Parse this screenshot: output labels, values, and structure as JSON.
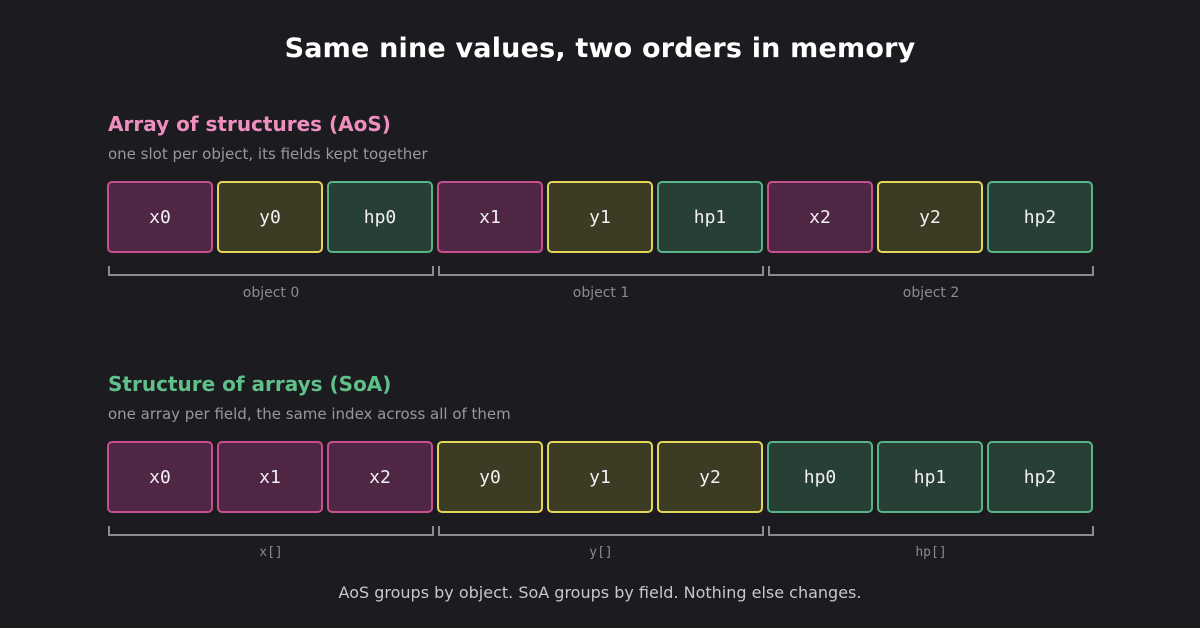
{
  "title": "Same nine values, two orders in memory",
  "colors": {
    "background": "#1c1b1f",
    "x_fill": "#4f2744",
    "x_border": "#c6508f",
    "y_fill": "#3c3b24",
    "y_border": "#e3d659",
    "hp_fill": "#283f36",
    "hp_border": "#57b488",
    "aos_heading": "#ef8fc0",
    "soa_heading": "#5fc08a"
  },
  "aos": {
    "heading": "Array of structures (AoS)",
    "subtitle": "one slot per object, its fields kept together",
    "cells": [
      {
        "label": "x0",
        "field": "x"
      },
      {
        "label": "y0",
        "field": "y"
      },
      {
        "label": "hp0",
        "field": "hp"
      },
      {
        "label": "x1",
        "field": "x"
      },
      {
        "label": "y1",
        "field": "y"
      },
      {
        "label": "hp1",
        "field": "hp"
      },
      {
        "label": "x2",
        "field": "x"
      },
      {
        "label": "y2",
        "field": "y"
      },
      {
        "label": "hp2",
        "field": "hp"
      }
    ],
    "groups": [
      "object 0",
      "object 1",
      "object 2"
    ]
  },
  "soa": {
    "heading": "Structure of arrays (SoA)",
    "subtitle": "one array per field, the same index across all of them",
    "cells": [
      {
        "label": "x0",
        "field": "x"
      },
      {
        "label": "x1",
        "field": "x"
      },
      {
        "label": "x2",
        "field": "x"
      },
      {
        "label": "y0",
        "field": "y"
      },
      {
        "label": "y1",
        "field": "y"
      },
      {
        "label": "y2",
        "field": "y"
      },
      {
        "label": "hp0",
        "field": "hp"
      },
      {
        "label": "hp1",
        "field": "hp"
      },
      {
        "label": "hp2",
        "field": "hp"
      }
    ],
    "groups": [
      "x[]",
      "y[]",
      "hp[]"
    ]
  },
  "footer": "AoS groups by object. SoA groups by field. Nothing else changes."
}
